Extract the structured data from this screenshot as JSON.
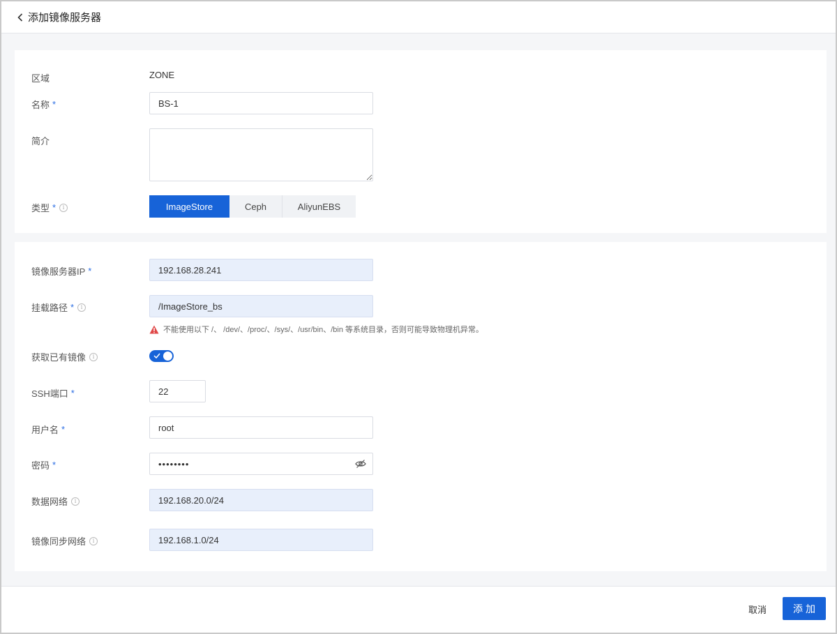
{
  "header": {
    "title": "添加镜像服务器"
  },
  "form": {
    "zone": {
      "label": "区域",
      "value": "ZONE"
    },
    "name": {
      "label": "名称",
      "required": "*",
      "value": "BS-1"
    },
    "description": {
      "label": "简介",
      "value": ""
    },
    "type": {
      "label": "类型",
      "required": "*",
      "options": [
        "ImageStore",
        "Ceph",
        "AliyunEBS"
      ],
      "selected": "ImageStore"
    },
    "server_ip": {
      "label": "镜像服务器IP",
      "required": "*",
      "value": "192.168.28.241"
    },
    "mount_path": {
      "label": "挂载路径",
      "required": "*",
      "value": "/ImageStore_bs",
      "warning": "不能使用以下 /、 /dev/、/proc/、/sys/、/usr/bin、/bin 等系统目录，否则可能导致物理机异常。"
    },
    "import_images": {
      "label": "获取已有镜像",
      "enabled": true
    },
    "ssh_port": {
      "label": "SSH端口",
      "required": "*",
      "value": "22"
    },
    "username": {
      "label": "用户名",
      "required": "*",
      "value": "root"
    },
    "password": {
      "label": "密码",
      "required": "*",
      "value": "••••••••"
    },
    "data_network": {
      "label": "数据网络",
      "value": "192.168.20.0/24"
    },
    "sync_network": {
      "label": "镜像同步网络",
      "value": "192.168.1.0/24"
    }
  },
  "footer": {
    "cancel_label": "取消",
    "add_label": "添加"
  },
  "colors": {
    "primary": "#1763d8",
    "filled_input": "#e8effb",
    "warning": "#e04848"
  }
}
